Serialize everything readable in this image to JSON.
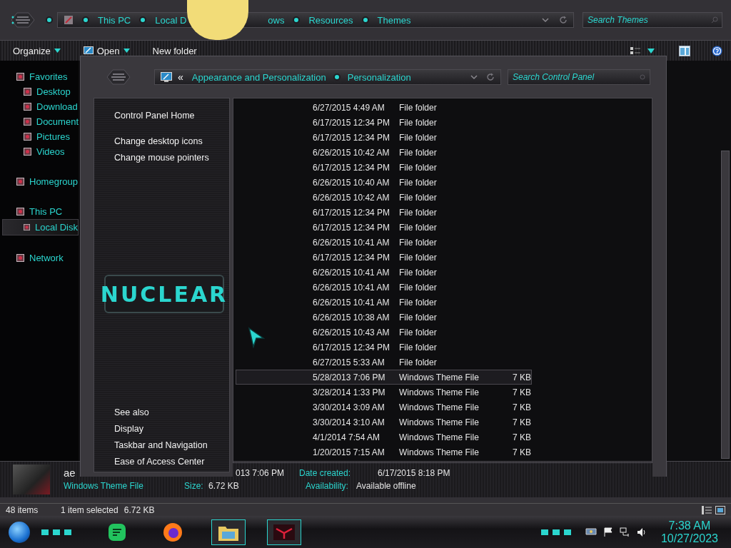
{
  "explorer": {
    "address": {
      "crumbs_before": [
        "This PC",
        "Local D"
      ],
      "crumbs_after": [
        "ows",
        "Resources",
        "Themes"
      ]
    },
    "search": {
      "placeholder": "Search Themes"
    },
    "toolbar": {
      "organize": "Organize",
      "open": "Open",
      "new_folder": "New folder"
    },
    "nav": [
      {
        "label": "Favorites",
        "selected": false,
        "children": [
          {
            "label": "Desktop",
            "selected": false
          },
          {
            "label": "Download",
            "selected": false
          },
          {
            "label": "Document",
            "selected": false
          },
          {
            "label": "Pictures",
            "selected": false
          },
          {
            "label": "Videos",
            "selected": false
          }
        ]
      },
      {
        "label": "Homegroup",
        "selected": false
      },
      {
        "label": "This PC",
        "selected": false,
        "children": [
          {
            "label": "Local Disk",
            "selected": true
          }
        ]
      },
      {
        "label": "Network",
        "selected": false
      }
    ],
    "files": [
      {
        "date": "6/27/2015 4:49 AM",
        "type": "File folder",
        "selected": false
      },
      {
        "date": "6/17/2015 12:34 PM",
        "type": "File folder",
        "selected": false
      },
      {
        "date": "6/17/2015 12:34 PM",
        "type": "File folder",
        "selected": false
      },
      {
        "date": "6/26/2015 10:42 AM",
        "type": "File folder",
        "selected": false
      },
      {
        "date": "6/17/2015 12:34 PM",
        "type": "File folder",
        "selected": false
      },
      {
        "date": "6/26/2015 10:40 AM",
        "type": "File folder",
        "selected": false
      },
      {
        "date": "6/26/2015 10:42 AM",
        "type": "File folder",
        "selected": false
      },
      {
        "date": "6/17/2015 12:34 PM",
        "type": "File folder",
        "selected": false
      },
      {
        "date": "6/17/2015 12:34 PM",
        "type": "File folder",
        "selected": false
      },
      {
        "date": "6/26/2015 10:41 AM",
        "type": "File folder",
        "selected": false
      },
      {
        "date": "6/17/2015 12:34 PM",
        "type": "File folder",
        "selected": false
      },
      {
        "date": "6/26/2015 10:41 AM",
        "type": "File folder",
        "selected": false
      },
      {
        "date": "6/26/2015 10:41 AM",
        "type": "File folder",
        "selected": false
      },
      {
        "date": "6/26/2015 10:41 AM",
        "type": "File folder",
        "selected": false
      },
      {
        "date": "6/26/2015 10:38 AM",
        "type": "File folder",
        "selected": false
      },
      {
        "date": "6/26/2015 10:43 AM",
        "type": "File folder",
        "selected": false
      },
      {
        "date": "6/17/2015 12:34 PM",
        "type": "File folder",
        "selected": false
      },
      {
        "date": "6/27/2015 5:33 AM",
        "type": "File folder",
        "selected": false
      },
      {
        "date": "5/28/2013 7:06 PM",
        "type": "Windows Theme File",
        "size": "7 KB",
        "selected": true
      },
      {
        "date": "3/28/2014 1:33 PM",
        "type": "Windows Theme File",
        "size": "7 KB",
        "selected": false
      },
      {
        "date": "3/30/2014 3:09 AM",
        "type": "Windows Theme File",
        "size": "7 KB",
        "selected": false
      },
      {
        "date": "3/30/2014 3:10 AM",
        "type": "Windows Theme File",
        "size": "7 KB",
        "selected": false
      },
      {
        "date": "4/1/2014 7:54 AM",
        "type": "Windows Theme File",
        "size": "7 KB",
        "selected": false
      },
      {
        "date": "1/20/2015 7:15 AM",
        "type": "Windows Theme File",
        "size": "7 KB",
        "selected": false
      }
    ],
    "details": {
      "name": "ae",
      "modified": "013 7:06 PM",
      "created_label": "Date created:",
      "created": "6/17/2015 8:18 PM",
      "type": "Windows Theme File",
      "size_label": "Size:",
      "size": "6.72 KB",
      "availability_label": "Availability:",
      "availability": "Available offline"
    },
    "status": {
      "count": "48 items",
      "selection": "1 item selected",
      "selection_size": "6.72 KB"
    }
  },
  "control_panel": {
    "address": {
      "back": "«",
      "crumbs": [
        "Appearance and Personalization",
        "Personalization"
      ]
    },
    "search": {
      "placeholder": "Search Control Panel"
    },
    "tasks": [
      "Control Panel Home",
      "Change desktop icons",
      "Change mouse pointers"
    ],
    "logo": "NUCLEAR",
    "see_also": {
      "title": "See also",
      "links": [
        "Display",
        "Taskbar and Navigation",
        "Ease of Access Center"
      ]
    }
  },
  "taskbar": {
    "apps": [
      {
        "active": false
      },
      {
        "active": false
      },
      {
        "active": true
      },
      {
        "active": true
      }
    ],
    "clock": {
      "time": "7:38 AM",
      "date": "10/27/2023"
    }
  }
}
